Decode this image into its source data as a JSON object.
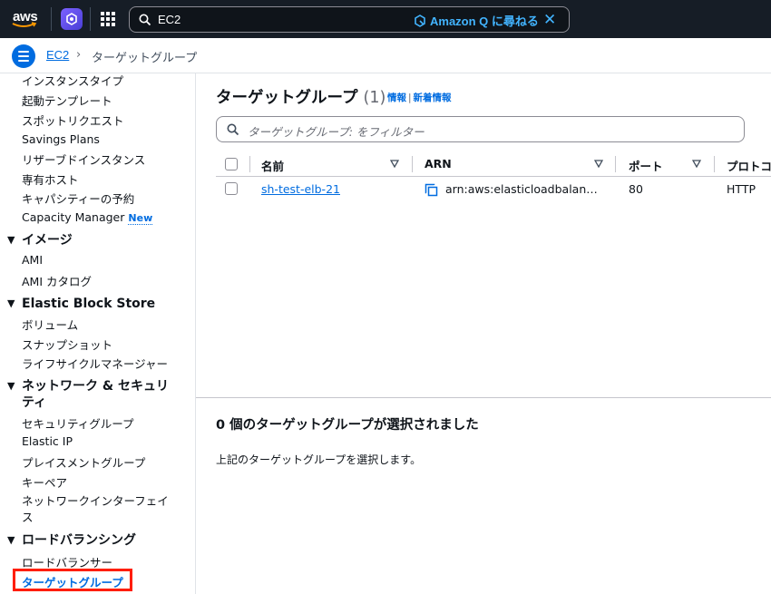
{
  "topnav": {
    "logo_text": "aws",
    "search_value": "EC2",
    "amazonq_label": "Amazon Q に尋ねる",
    "clear_symbol": "✕",
    "colors": {
      "background": "#161d26",
      "accent": "#42b4ff"
    }
  },
  "breadcrumb": {
    "root": "EC2",
    "separator": "›",
    "current": "ターゲットグループ"
  },
  "sidebar": {
    "items_top": [
      {
        "label": "インスタンスタイプ"
      },
      {
        "label": "起動テンプレート"
      },
      {
        "label": "スポットリクエスト"
      },
      {
        "label": "Savings Plans"
      },
      {
        "label": "リザーブドインスタンス"
      },
      {
        "label": "専有ホスト"
      },
      {
        "label": "キャパシティーの予約"
      },
      {
        "label": "Capacity Manager",
        "badge": "New"
      }
    ],
    "sections": [
      {
        "title": "イメージ",
        "items": [
          "AMI",
          "AMI カタログ"
        ]
      },
      {
        "title": "Elastic Block Store",
        "items": [
          "ボリューム",
          "スナップショット",
          "ライフサイクルマネージャー"
        ]
      },
      {
        "title_line1": "ネットワーク & セキュリ",
        "title_line2": "ティ",
        "items": [
          "セキュリティグループ",
          "Elastic IP",
          "プレイスメントグループ",
          "キーペア"
        ],
        "item_wrap_line1": "ネットワークインターフェイ",
        "item_wrap_line2": "ス"
      },
      {
        "title": "ロードバランシング",
        "items": [
          "ロードバランサー"
        ],
        "active_item": "ターゲットグループ"
      }
    ],
    "caret": "▼"
  },
  "main": {
    "title": "ターゲットグループ",
    "count": "(1)",
    "info_link": "情報",
    "info_sep": "|",
    "whats_new_link": "新着情報",
    "filter_placeholder": "ターゲットグループ: をフィルター",
    "columns": [
      "名前",
      "ARN",
      "ポート",
      "プロトコ"
    ],
    "rows": [
      {
        "name": "sh-test-elb-21",
        "arn": "arn:aws:elasticloadbalancing:",
        "port": "80",
        "protocol": "HTTP"
      }
    ],
    "selection_title": "0 個のターゲットグループが選択されました",
    "selection_desc": "上記のターゲットグループを選択します。"
  }
}
